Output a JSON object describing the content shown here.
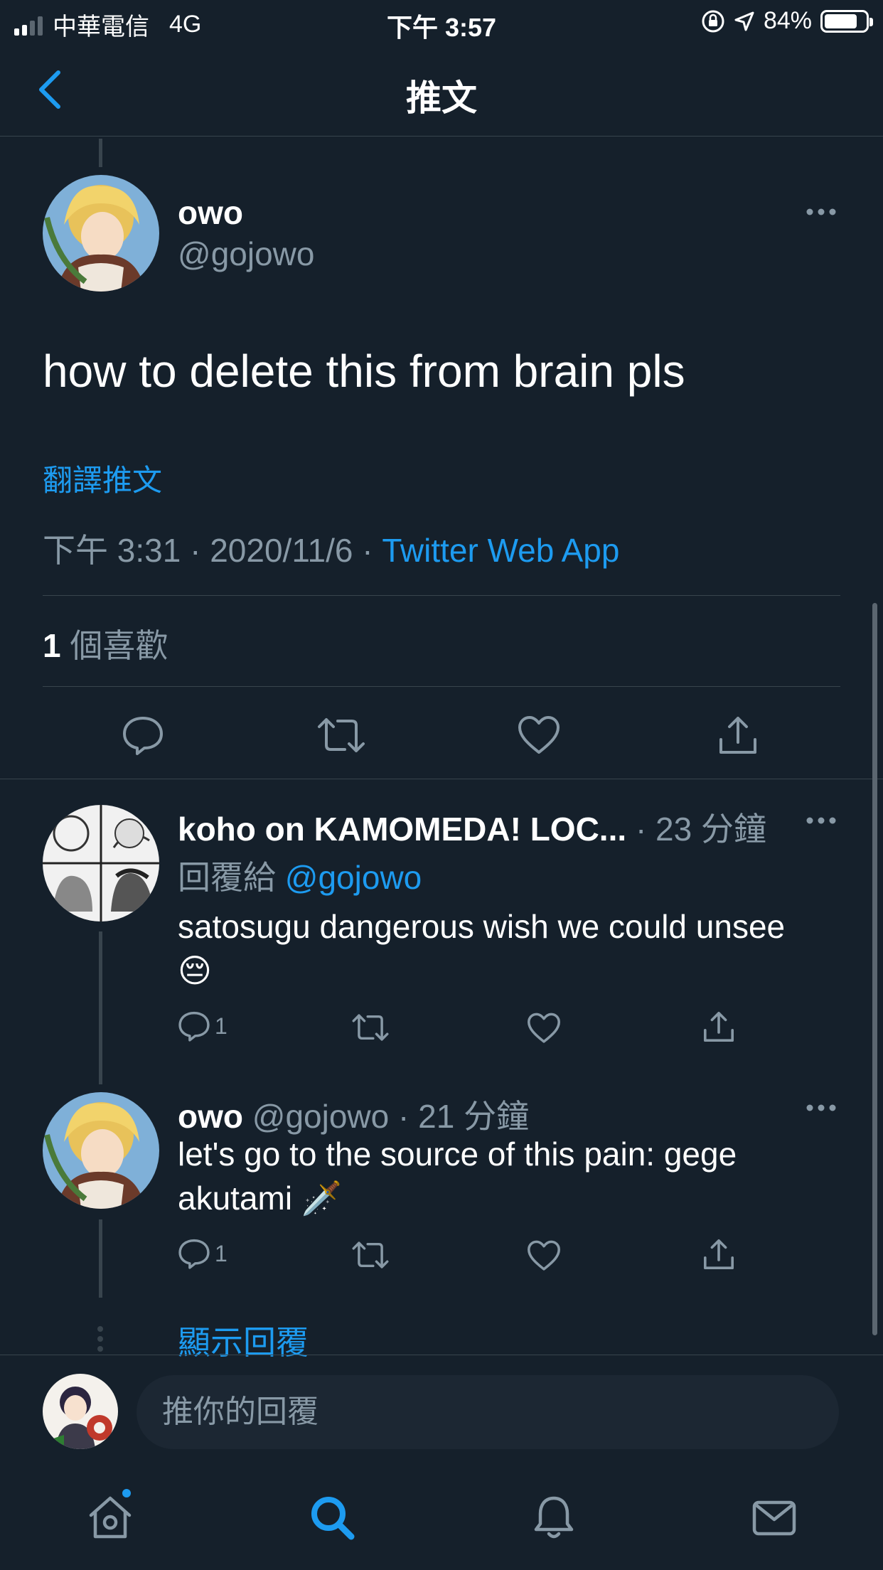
{
  "status_bar": {
    "carrier": "中華電信",
    "network": "4G",
    "time": "下午 3:57",
    "battery": "84%",
    "battery_level": 0.84
  },
  "nav": {
    "title": "推文",
    "back_icon": "chevron-left-icon"
  },
  "main_tweet": {
    "name": "owo",
    "handle": "@gojowo",
    "text": "how to delete this from brain pls",
    "translate": "翻譯推文",
    "time": "下午 3:31",
    "date": "2020/11/6",
    "source": "Twitter Web App",
    "likes_count": "1",
    "likes_label": "個喜歡"
  },
  "replies": [
    {
      "name": "koho on KAMOMEDA! LOC...",
      "time": "23 分鐘",
      "replying_label": "回覆給",
      "replying_to": "@gojowo",
      "text_line1": "satosugu dangerous wish we could unsee",
      "text_line2": "😔",
      "reply_count": "1"
    },
    {
      "name": "owo",
      "handle": "@gojowo",
      "time": "21 分鐘",
      "text_line1": "let's go to the source of this pain: gege",
      "text_line2": "akutami 🗡️",
      "reply_count": "1"
    }
  ],
  "show_replies": "顯示回覆",
  "compose": {
    "placeholder": "推你的回覆"
  },
  "tabbar": {
    "items": [
      "home-icon",
      "search-icon",
      "notifications-icon",
      "messages-icon"
    ],
    "active": "search-icon"
  },
  "colors": {
    "background": "#15202b",
    "accent": "#1d9bf0",
    "muted": "#8899a6",
    "divider": "#38444d"
  }
}
